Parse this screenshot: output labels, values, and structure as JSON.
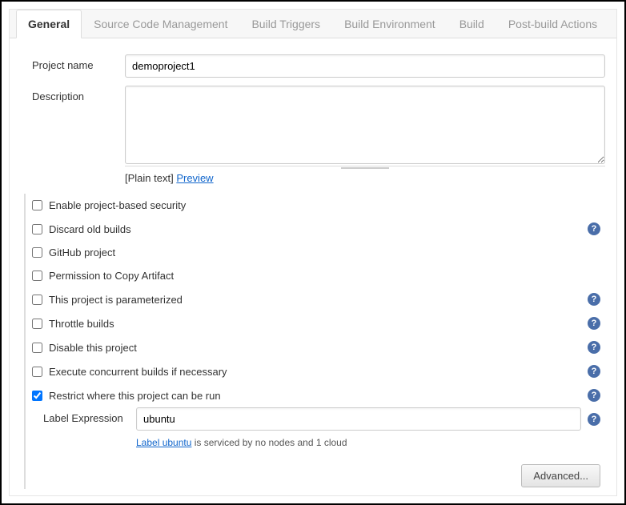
{
  "tabs": [
    {
      "label": "General",
      "active": true
    },
    {
      "label": "Source Code Management",
      "active": false
    },
    {
      "label": "Build Triggers",
      "active": false
    },
    {
      "label": "Build Environment",
      "active": false
    },
    {
      "label": "Build",
      "active": false
    },
    {
      "label": "Post-build Actions",
      "active": false
    }
  ],
  "fields": {
    "project_name_label": "Project name",
    "project_name_value": "demoproject1",
    "description_label": "Description",
    "description_value": "",
    "plain_text": "[Plain text]",
    "preview": "Preview",
    "label_expression_label": "Label Expression",
    "label_expression_value": "ubuntu",
    "label_msg_link": "Label ubuntu",
    "label_msg_tail": " is serviced by no nodes and 1 cloud"
  },
  "options": [
    {
      "label": "Enable project-based security",
      "checked": false,
      "help": false
    },
    {
      "label": "Discard old builds",
      "checked": false,
      "help": true
    },
    {
      "label": "GitHub project",
      "checked": false,
      "help": false
    },
    {
      "label": "Permission to Copy Artifact",
      "checked": false,
      "help": false
    },
    {
      "label": "This project is parameterized",
      "checked": false,
      "help": true
    },
    {
      "label": "Throttle builds",
      "checked": false,
      "help": true
    },
    {
      "label": "Disable this project",
      "checked": false,
      "help": true
    },
    {
      "label": "Execute concurrent builds if necessary",
      "checked": false,
      "help": true
    },
    {
      "label": "Restrict where this project can be run",
      "checked": true,
      "help": true
    }
  ],
  "buttons": {
    "advanced": "Advanced..."
  },
  "glyphs": {
    "help": "?"
  }
}
